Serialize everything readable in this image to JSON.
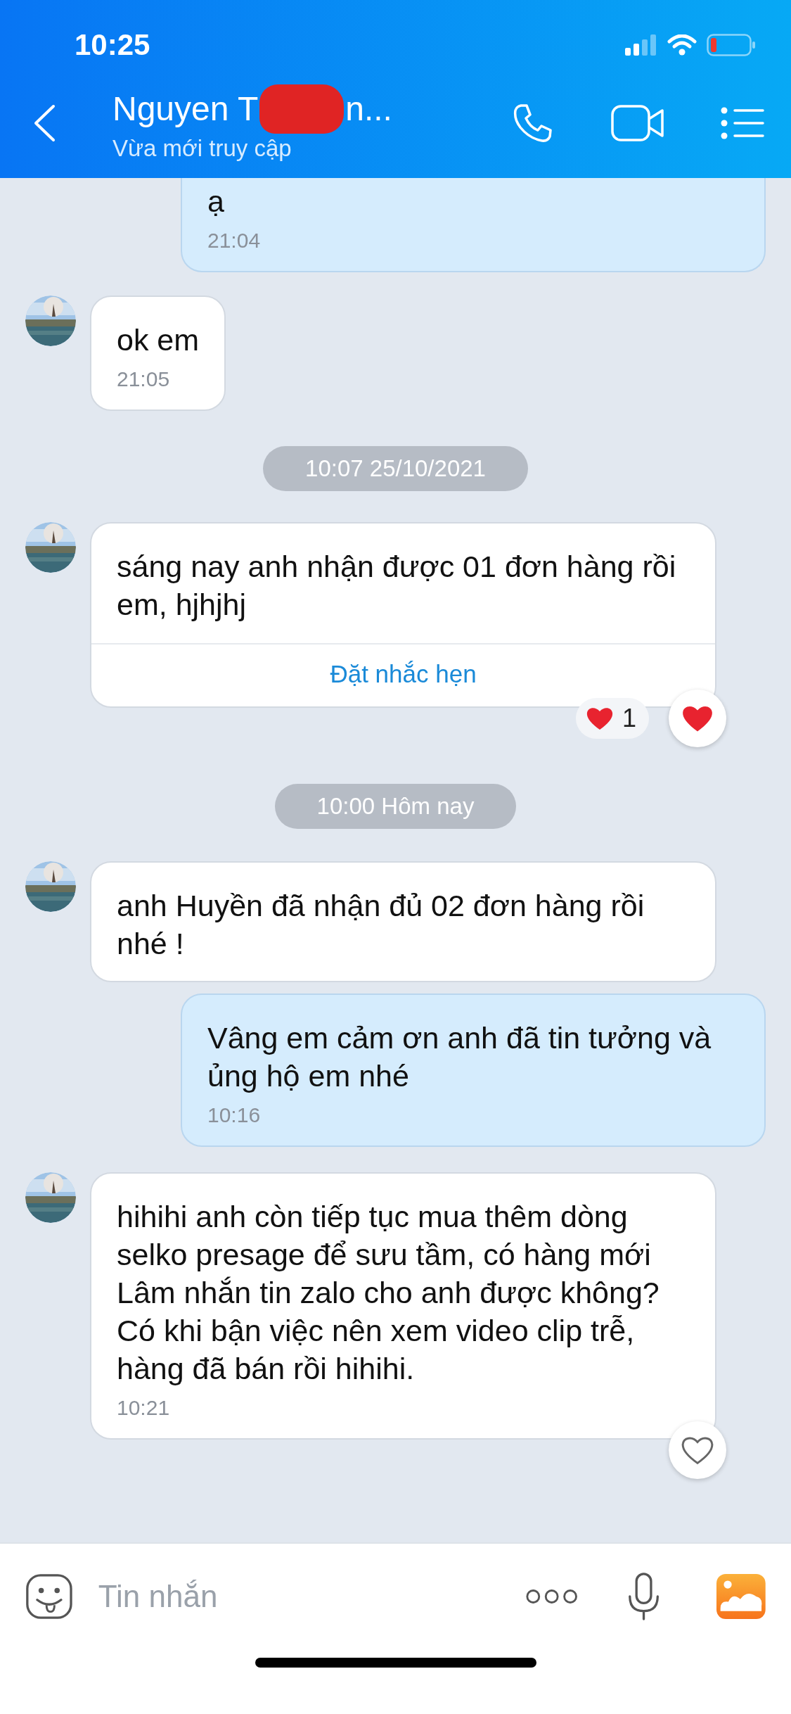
{
  "status_bar": {
    "time": "10:25"
  },
  "header": {
    "name_start": "Nguyen T",
    "name_end": "n...",
    "redacted": true,
    "subtitle": "Vừa mới truy cập"
  },
  "messages": [
    {
      "kind": "outgoing",
      "text": "ạ",
      "time": "21:04",
      "cut_top": true
    },
    {
      "kind": "incoming",
      "text": "ok em",
      "time": "21:05"
    },
    {
      "kind": "date",
      "text": "10:07 25/10/2021"
    },
    {
      "kind": "incoming",
      "text": "sáng nay anh nhận được 01 đơn hàng rồi em, hjhjhj",
      "action": "Đặt nhắc hẹn",
      "reaction_count": "1",
      "liked": true
    },
    {
      "kind": "date",
      "text": "10:00 Hôm nay"
    },
    {
      "kind": "incoming",
      "text": "anh Huyền đã nhận đủ 02 đơn hàng rồi nhé !"
    },
    {
      "kind": "outgoing",
      "text": "Vâng em cảm ơn anh đã tin tưởng và ủng hộ em nhé",
      "time": "10:16"
    },
    {
      "kind": "incoming",
      "text": "hihihi anh còn tiếp tục mua thêm dòng selko presage để sưu tầm, có hàng mới Lâm nhắn tin zalo cho anh được không? Có khi bận việc nên xem video clip trễ, hàng đã bán rồi hihihi.",
      "time": "10:21",
      "liked": false
    }
  ],
  "composer": {
    "placeholder": "Tin nhắn"
  }
}
